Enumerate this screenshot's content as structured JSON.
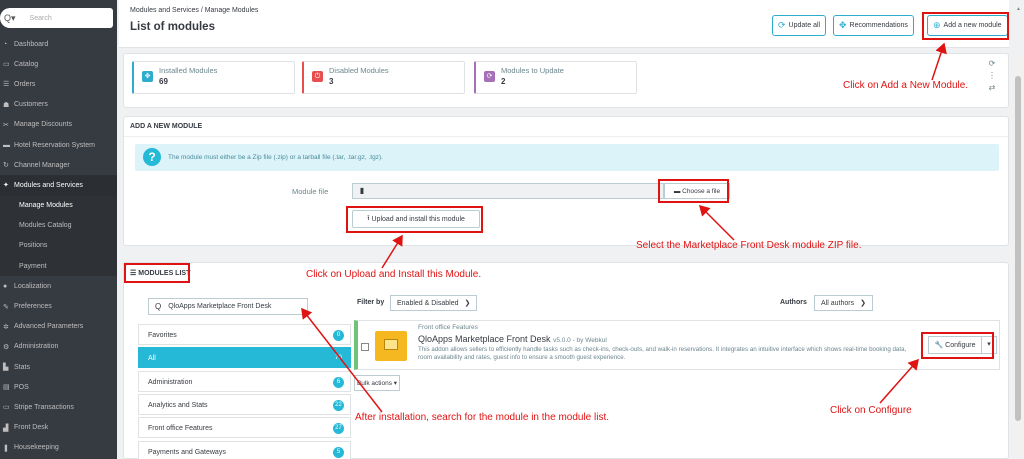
{
  "sidebar": {
    "search_placeholder": "Search",
    "items": [
      {
        "label": "Dashboard",
        "icon": "dashboard-icon",
        "glyph": "◔"
      },
      {
        "label": "Catalog",
        "icon": "catalog-icon",
        "glyph": "▭"
      },
      {
        "label": "Orders",
        "icon": "orders-icon",
        "glyph": "☰"
      },
      {
        "label": "Customers",
        "icon": "customers-icon",
        "glyph": "☗"
      },
      {
        "label": "Manage Discounts",
        "icon": "discounts-icon",
        "glyph": "✂"
      },
      {
        "label": "Hotel Reservation System",
        "icon": "hotel-icon",
        "glyph": "▬"
      },
      {
        "label": "Channel Manager",
        "icon": "channel-icon",
        "glyph": "↻"
      },
      {
        "label": "Modules and Services",
        "icon": "puzzle-icon",
        "glyph": "✦"
      },
      {
        "label": "Manage Modules",
        "sub": true
      },
      {
        "label": "Modules Catalog",
        "sub": true
      },
      {
        "label": "Positions",
        "sub": true
      },
      {
        "label": "Payment",
        "sub": true
      },
      {
        "label": "Localization",
        "icon": "globe-icon",
        "glyph": "●"
      },
      {
        "label": "Preferences",
        "icon": "wrench-icon",
        "glyph": "✎"
      },
      {
        "label": "Advanced Parameters",
        "icon": "gears-icon",
        "glyph": "✲"
      },
      {
        "label": "Administration",
        "icon": "admin-icon",
        "glyph": "⚙"
      },
      {
        "label": "Stats",
        "icon": "stats-icon",
        "glyph": "▙"
      },
      {
        "label": "POS",
        "icon": "pos-icon",
        "glyph": "▤"
      },
      {
        "label": "Stripe Transactions",
        "icon": "stripe-icon",
        "glyph": "▭"
      },
      {
        "label": "Front Desk",
        "icon": "frontdesk-icon",
        "glyph": "▟"
      },
      {
        "label": "Housekeeping",
        "icon": "housekeeping-icon",
        "glyph": "❚"
      }
    ]
  },
  "header": {
    "breadcrumb": "Modules and Services  /  Manage Modules",
    "title": "List of modules",
    "buttons": {
      "update_all": "Update all",
      "recommendations": "Recommendations",
      "add_new": "Add a new module"
    }
  },
  "kpis": [
    {
      "label": "Installed Modules",
      "value": "69",
      "color": "#2eacce",
      "icon": "puzzle-icon"
    },
    {
      "label": "Disabled Modules",
      "value": "3",
      "color": "#e84e4e",
      "icon": "power-icon"
    },
    {
      "label": "Modules to Update",
      "value": "2",
      "color": "#a76fb6",
      "icon": "refresh-icon"
    }
  ],
  "add_module": {
    "heading": "ADD A NEW MODULE",
    "info": "The module must either be a Zip file (.zip) or a tarball file (.tar, .tar.gz, .tgz).",
    "file_label": "Module file",
    "choose": "Choose a file",
    "upload": "Upload and install this module"
  },
  "modules_list": {
    "heading": "MODULES LIST",
    "search_value": "QloApps Marketplace Front Desk",
    "filter_by": "Filter by",
    "filter_value": "Enabled & Disabled",
    "authors_label": "Authors",
    "authors_value": "All authors",
    "categories": [
      {
        "label": "Favorites",
        "count": "0"
      },
      {
        "label": "All",
        "count": "70",
        "active": true
      },
      {
        "label": "Administration",
        "count": "6"
      },
      {
        "label": "Analytics and Stats",
        "count": "22"
      },
      {
        "label": "Front office Features",
        "count": "27"
      },
      {
        "label": "Payments and Gateways",
        "count": "5"
      }
    ],
    "module": {
      "category": "Front office Features",
      "name": "QloApps Marketplace Front Desk",
      "version": "v5.0.0 - by Webkul",
      "description": "This addon allows sellers to efficiently handle tasks such as check-ins, check-outs, and walk-in reservations. It integrates an intuitive interface which shows real-time booking data, room availability and rates, guest info to ensure a smooth guest experience.",
      "configure": "Configure"
    },
    "bulk": "Bulk actions"
  },
  "annotations": {
    "add_new": "Click on Add a New Module.",
    "select_zip": "Select the Marketplace Front Desk module ZIP file.",
    "upload": "Click on Upload and Install this Module.",
    "search": "After installation, search for the module in the module list.",
    "configure": "Click on Configure",
    "color": "#e01313"
  }
}
